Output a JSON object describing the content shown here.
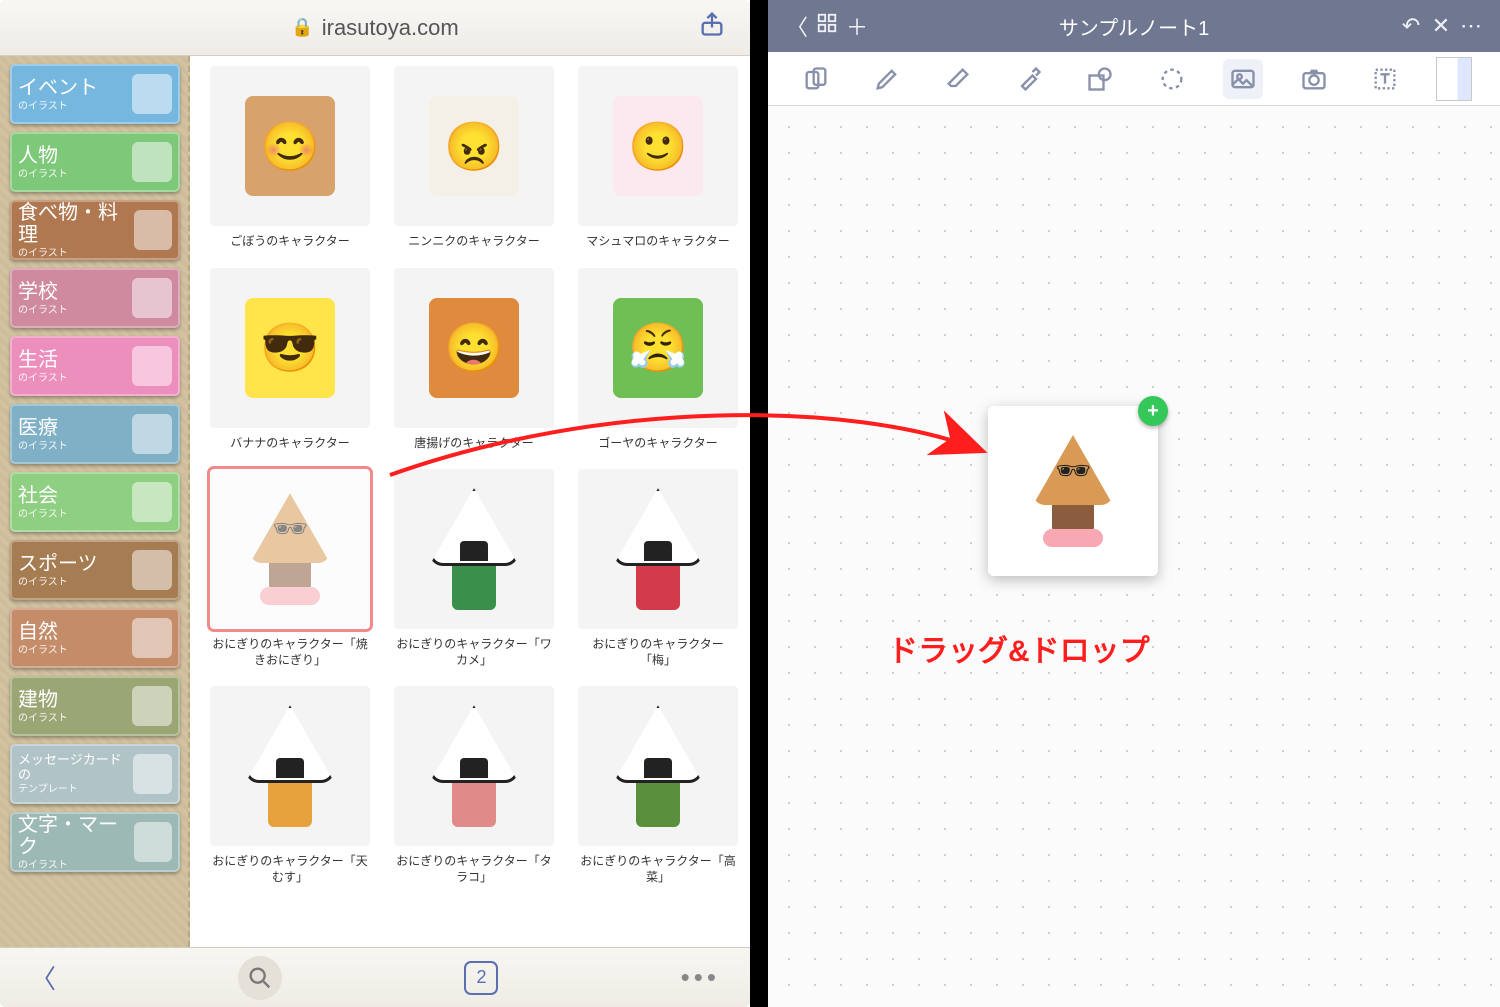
{
  "safari": {
    "url": "irasutoya.com",
    "tab_count": "2"
  },
  "sidebar": {
    "items": [
      {
        "label": "イベント",
        "sub": "のイラスト",
        "bg": "#76b7e0"
      },
      {
        "label": "人物",
        "sub": "のイラスト",
        "bg": "#7ec87a"
      },
      {
        "label": "食べ物・料理",
        "sub": "のイラスト",
        "bg": "#b07850"
      },
      {
        "label": "学校",
        "sub": "のイラスト",
        "bg": "#cf8aa0"
      },
      {
        "label": "生活",
        "sub": "のイラスト",
        "bg": "#ec8fbd"
      },
      {
        "label": "医療",
        "sub": "のイラスト",
        "bg": "#7fb0c6"
      },
      {
        "label": "社会",
        "sub": "のイラスト",
        "bg": "#8fcf82"
      },
      {
        "label": "スポーツ",
        "sub": "のイラスト",
        "bg": "#a67c52"
      },
      {
        "label": "自然",
        "sub": "のイラスト",
        "bg": "#c58c6a"
      },
      {
        "label": "建物",
        "sub": "のイラスト",
        "bg": "#9aa775"
      },
      {
        "label": "メッセージカードの",
        "sub": "テンプレート",
        "bg": "#b0c4c8",
        "small": true
      },
      {
        "label": "文字・マーク",
        "sub": "のイラスト",
        "bg": "#9cb9b5"
      }
    ]
  },
  "grid": {
    "items": [
      {
        "caption": "ごぼうのキャラクター",
        "bg": "#d7a26b",
        "face": "😊"
      },
      {
        "caption": "ニンニクのキャラクター",
        "bg": "#f4f0e8",
        "face": "😠"
      },
      {
        "caption": "マシュマロのキャラクター",
        "bg": "#fbe9ef",
        "face": "🙂"
      },
      {
        "caption": "バナナのキャラクター",
        "bg": "#ffe54a",
        "face": "😎"
      },
      {
        "caption": "唐揚げのキャラクター",
        "bg": "#e08a3d",
        "face": "😄"
      },
      {
        "caption": "ゴーヤのキャラクター",
        "bg": "#6fbf55",
        "face": "😤"
      },
      {
        "caption": "おにぎりのキャラクター「焼きおにぎり」",
        "selected": true,
        "type": "yaki"
      },
      {
        "caption": "おにぎりのキャラクター「ワカメ」",
        "type": "onigiri",
        "accent": "#3a8f4a"
      },
      {
        "caption": "おにぎりのキャラクター「梅」",
        "type": "onigiri",
        "accent": "#d43b4a"
      },
      {
        "caption": "おにぎりのキャラクター「天むす」",
        "type": "onigiri",
        "accent": "#e5a23d"
      },
      {
        "caption": "おにぎりのキャラクター「タラコ」",
        "type": "onigiri",
        "accent": "#e08a8a"
      },
      {
        "caption": "おにぎりのキャラクター「高菜」",
        "type": "onigiri",
        "accent": "#5a8f3d"
      }
    ]
  },
  "note": {
    "title": "サンプルノート1",
    "tools": [
      {
        "name": "shapes-tool",
        "icon": "shapes"
      },
      {
        "name": "pen-tool",
        "icon": "pen"
      },
      {
        "name": "eraser-tool",
        "icon": "eraser"
      },
      {
        "name": "highlighter-tool",
        "icon": "marker"
      },
      {
        "name": "shape-tool",
        "icon": "shape"
      },
      {
        "name": "lasso-tool",
        "icon": "lasso"
      },
      {
        "name": "image-tool",
        "icon": "image",
        "selected": true
      },
      {
        "name": "camera-tool",
        "icon": "camera"
      },
      {
        "name": "text-tool",
        "icon": "text"
      }
    ]
  },
  "annotation": {
    "text": "ドラッグ&ドロップ",
    "plus": "+"
  }
}
